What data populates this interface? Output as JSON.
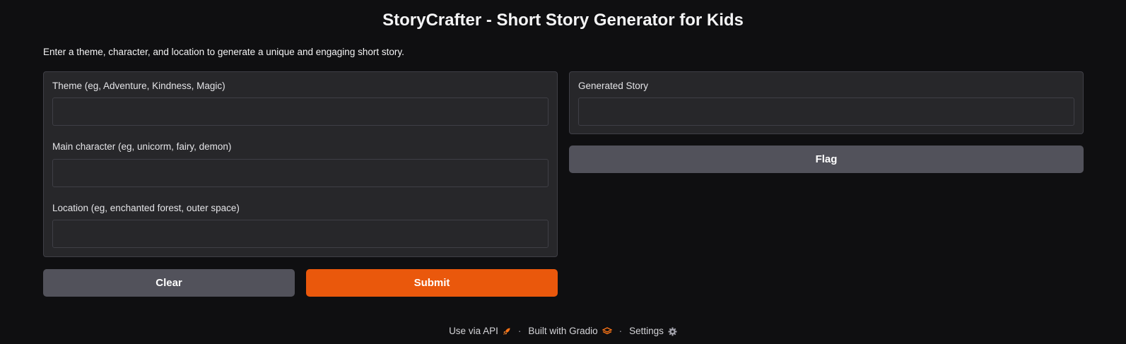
{
  "header": {
    "title": "StoryCrafter - Short Story Generator for Kids",
    "description": "Enter a theme, character, and location to generate a unique and engaging short story."
  },
  "inputs": {
    "theme_label": "Theme (eg, Adventure, Kindness, Magic)",
    "theme_value": "",
    "character_label": "Main character (eg, unicorm, fairy, demon)",
    "character_value": "",
    "location_label": "Location (eg, enchanted forest, outer space)",
    "location_value": ""
  },
  "output": {
    "label": "Generated Story",
    "value": ""
  },
  "buttons": {
    "clear": "Clear",
    "submit": "Submit",
    "flag": "Flag"
  },
  "footer": {
    "api_link": "Use via API",
    "built_with": "Built with Gradio",
    "settings": "Settings",
    "separator": "·"
  },
  "colors": {
    "background": "#0f0f11",
    "panel": "#27272a",
    "border": "#3f3f46",
    "primary": "#ea580c",
    "secondary": "#52525b"
  },
  "icons": {
    "api": "rocket-icon",
    "gradio": "gradio-logo-icon",
    "settings": "gear-icon"
  }
}
